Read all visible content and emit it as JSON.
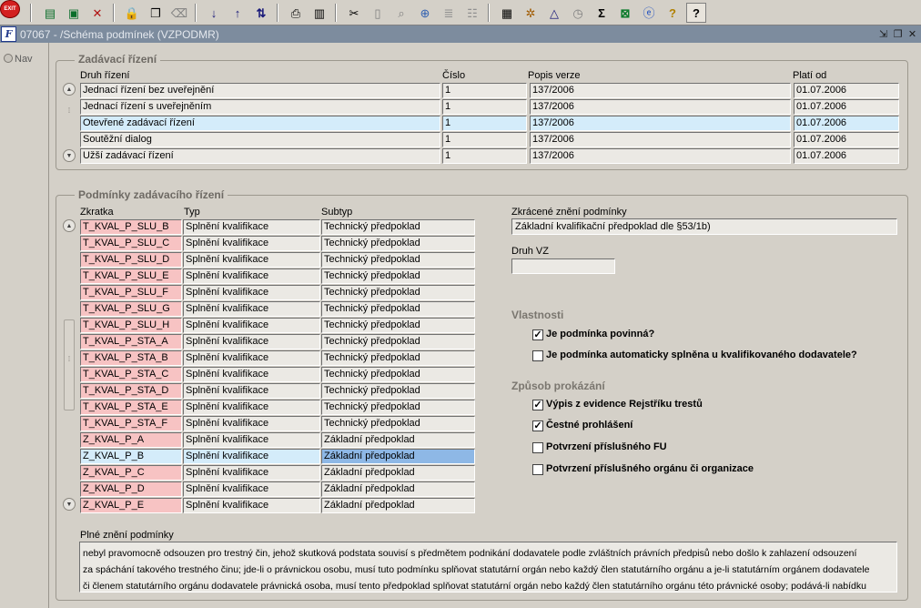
{
  "toolbar": {
    "exit_label": "EXIT",
    "icons": [
      "exit-icon",
      "new-record-icon",
      "save-record-icon",
      "delete-record-icon",
      "lock-icon",
      "copy-icon",
      "clear-icon",
      "sort-asc-icon",
      "sort-desc-icon",
      "sort-multi-icon",
      "print-icon",
      "print-preview-icon",
      "cut-icon",
      "paste-icon",
      "search-icon",
      "indent-icon",
      "tree-icon",
      "report-icon",
      "settings-icon",
      "filter-icon",
      "calendar-icon",
      "sum-icon",
      "excel-icon",
      "web-icon",
      "help-query-icon",
      "help-icon"
    ]
  },
  "window": {
    "title": "07067 - /Schéma podmínek (VZPODMR)"
  },
  "nav": {
    "label": "Nav"
  },
  "zadavaci": {
    "title": "Zadávací řízení",
    "headers": {
      "druh": "Druh řízení",
      "cislo": "Číslo",
      "popis": "Popis verze",
      "plati": "Platí od"
    },
    "rows": [
      {
        "druh": "Jednací řízení bez uveřejnění",
        "cislo": "1",
        "popis": "137/2006",
        "plati": "01.07.2006"
      },
      {
        "druh": "Jednací řízení s uveřejněním",
        "cislo": "1",
        "popis": "137/2006",
        "plati": "01.07.2006"
      },
      {
        "druh": "Otevřené zadávací řízení",
        "cislo": "1",
        "popis": "137/2006",
        "plati": "01.07.2006"
      },
      {
        "druh": "Soutěžní dialog",
        "cislo": "1",
        "popis": "137/2006",
        "plati": "01.07.2006"
      },
      {
        "druh": "Užší zadávací řízení",
        "cislo": "1",
        "popis": "137/2006",
        "plati": "01.07.2006"
      }
    ]
  },
  "podminky": {
    "title": "Podmínky zadávacího řízení",
    "headers": {
      "zkratka": "Zkratka",
      "typ": "Typ",
      "subtyp": "Subtyp"
    },
    "rows": [
      {
        "zkratka": "T_KVAL_P_SLU_B",
        "typ": "Splnění kvalifikace",
        "subtyp": "Technický předpoklad"
      },
      {
        "zkratka": "T_KVAL_P_SLU_C",
        "typ": "Splnění kvalifikace",
        "subtyp": "Technický předpoklad"
      },
      {
        "zkratka": "T_KVAL_P_SLU_D",
        "typ": "Splnění kvalifikace",
        "subtyp": "Technický předpoklad"
      },
      {
        "zkratka": "T_KVAL_P_SLU_E",
        "typ": "Splnění kvalifikace",
        "subtyp": "Technický předpoklad"
      },
      {
        "zkratka": "T_KVAL_P_SLU_F",
        "typ": "Splnění kvalifikace",
        "subtyp": "Technický předpoklad"
      },
      {
        "zkratka": "T_KVAL_P_SLU_G",
        "typ": "Splnění kvalifikace",
        "subtyp": "Technický předpoklad"
      },
      {
        "zkratka": "T_KVAL_P_SLU_H",
        "typ": "Splnění kvalifikace",
        "subtyp": "Technický předpoklad"
      },
      {
        "zkratka": "T_KVAL_P_STA_A",
        "typ": "Splnění kvalifikace",
        "subtyp": "Technický předpoklad"
      },
      {
        "zkratka": "T_KVAL_P_STA_B",
        "typ": "Splnění kvalifikace",
        "subtyp": "Technický předpoklad"
      },
      {
        "zkratka": "T_KVAL_P_STA_C",
        "typ": "Splnění kvalifikace",
        "subtyp": "Technický předpoklad"
      },
      {
        "zkratka": "T_KVAL_P_STA_D",
        "typ": "Splnění kvalifikace",
        "subtyp": "Technický předpoklad"
      },
      {
        "zkratka": "T_KVAL_P_STA_E",
        "typ": "Splnění kvalifikace",
        "subtyp": "Technický předpoklad"
      },
      {
        "zkratka": "T_KVAL_P_STA_F",
        "typ": "Splnění kvalifikace",
        "subtyp": "Technický předpoklad"
      },
      {
        "zkratka": "Z_KVAL_P_A",
        "typ": "Splnění kvalifikace",
        "subtyp": "Základní předpoklad"
      },
      {
        "zkratka": "Z_KVAL_P_B",
        "typ": "Splnění kvalifikace",
        "subtyp": "Základní předpoklad"
      },
      {
        "zkratka": "Z_KVAL_P_C",
        "typ": "Splnění kvalifikace",
        "subtyp": "Základní předpoklad"
      },
      {
        "zkratka": "Z_KVAL_P_D",
        "typ": "Splnění kvalifikace",
        "subtyp": "Základní předpoklad"
      },
      {
        "zkratka": "Z_KVAL_P_E",
        "typ": "Splnění kvalifikace",
        "subtyp": "Základní předpoklad"
      }
    ],
    "selected_index": 14,
    "zkracene_label": "Zkrácené znění podmínky",
    "zkracene_value": "Základní kvalifikační předpoklad dle §53/1b)",
    "druh_vz_label": "Druh VZ",
    "druh_vz_value": "",
    "vlastnosti_title": "Vlastnosti",
    "vlastnosti": [
      {
        "label": "Je podmínka povinná?",
        "checked": true
      },
      {
        "label": "Je podmínka automaticky splněna u kvalifikovaného dodavatele?",
        "checked": false
      }
    ],
    "zpusob_title": "Způsob prokázání",
    "zpusob": [
      {
        "label": "Výpis z evidence Rejstříku trestů",
        "checked": true
      },
      {
        "label": "Čestné prohlášení",
        "checked": true
      },
      {
        "label": "Potvrzení příslušného FU",
        "checked": false
      },
      {
        "label": "Potvrzení příslušného orgánu či organizace",
        "checked": false
      }
    ],
    "plne_label": "Plné znění podmínky",
    "plne_lines": [
      "nebyl pravomocně odsouzen pro trestný čin, jehož skutková podstata souvisí s předmětem podnikání dodavatele podle zvláštních právních předpisů nebo došlo k zahlazení odsouzení",
      "za spáchání takového trestného činu; jde-li o právnickou osobu, musí tuto podmínku splňovat statutární orgán nebo každý člen statutárního orgánu a je-li statutárním orgánem dodavatele",
      "či členem statutárního orgánu dodavatele právnická osoba, musí tento předpoklad splňovat statutární orgán nebo každý člen statutárního orgánu této právnické osoby; podává-li nabídku"
    ]
  },
  "colors": {
    "titlebar": "#7d8c9e",
    "required_field": "#f7c3c3",
    "current_row": "#d4ecfa",
    "selected_cell": "#8eb8e6"
  }
}
